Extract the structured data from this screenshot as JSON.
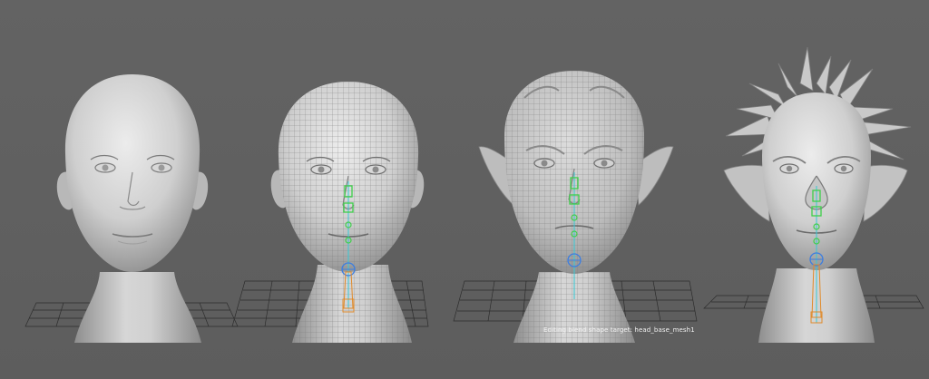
{
  "viewport": {
    "background_color": "#5f5f5f",
    "caption": "Editing blend shape target: head_base_mesh1"
  },
  "colors": {
    "mesh_light": "#e0e0e0",
    "mesh_shadow": "#8f8f8f",
    "wire": "#6a6a6a",
    "ground_grid": "#2d2d2d",
    "joint_green": "#3ecf4a",
    "joint_cyan": "#36c9d6",
    "joint_blue": "#3d7ee0",
    "joint_orange": "#e08a2a"
  },
  "models": [
    {
      "name": "base-head",
      "label": "smooth base head",
      "wireframe": false,
      "rig": false,
      "ears": "human",
      "spikes": false
    },
    {
      "name": "wire-head",
      "label": "wireframe head with rig",
      "wireframe": true,
      "rig": true,
      "ears": "human",
      "spikes": false
    },
    {
      "name": "elf-head",
      "label": "elf head with pointed ears",
      "wireframe": true,
      "rig": true,
      "ears": "pointed",
      "spikes": false
    },
    {
      "name": "spiky-head",
      "label": "spiked creature head",
      "wireframe": false,
      "rig": true,
      "ears": "pointed",
      "spikes": true
    }
  ]
}
